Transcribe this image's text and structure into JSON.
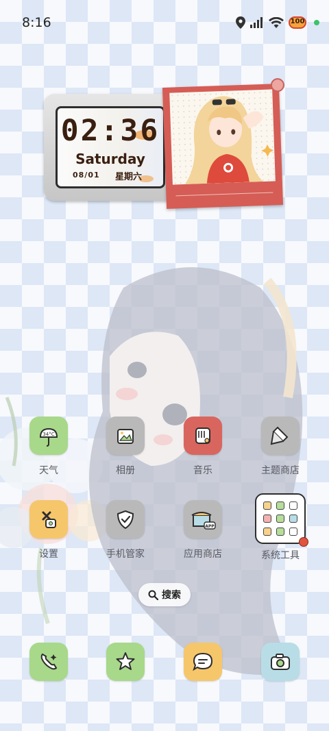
{
  "status_bar": {
    "time": "8:16",
    "battery": "100",
    "icons": [
      "location-icon",
      "signal-icon",
      "wifi-icon",
      "battery-icon"
    ],
    "indicator_color": "#3cc36a"
  },
  "clock_widget": {
    "time": "02:36",
    "day": "Saturday",
    "date": "08/01",
    "weekday": "星期六"
  },
  "apps": {
    "weather": {
      "label": "天气",
      "temp": "34°C",
      "color": "#a8d88a"
    },
    "gallery": {
      "label": "相册",
      "color": "#b9b9b9"
    },
    "music": {
      "label": "音乐",
      "color": "#d8665e"
    },
    "themes": {
      "label": "主题商店",
      "color": "#b9b9b9"
    },
    "settings": {
      "label": "设置",
      "color": "#f6c66b"
    },
    "security": {
      "label": "手机管家",
      "color": "#b9b9b9"
    },
    "appstore": {
      "label": "应用商店",
      "badge": "APP",
      "color": "#b9b9b9"
    },
    "tools": {
      "label": "系统工具"
    }
  },
  "search": {
    "label": "搜索"
  },
  "dock": {
    "phone": {
      "color": "#a8d88a",
      "icon": "phone-icon"
    },
    "favorites": {
      "color": "#a8d88a",
      "icon": "star-icon"
    },
    "messages": {
      "color": "#f6c66b",
      "icon": "message-icon"
    },
    "camera": {
      "color": "#b8dde6",
      "icon": "camera-icon"
    }
  }
}
